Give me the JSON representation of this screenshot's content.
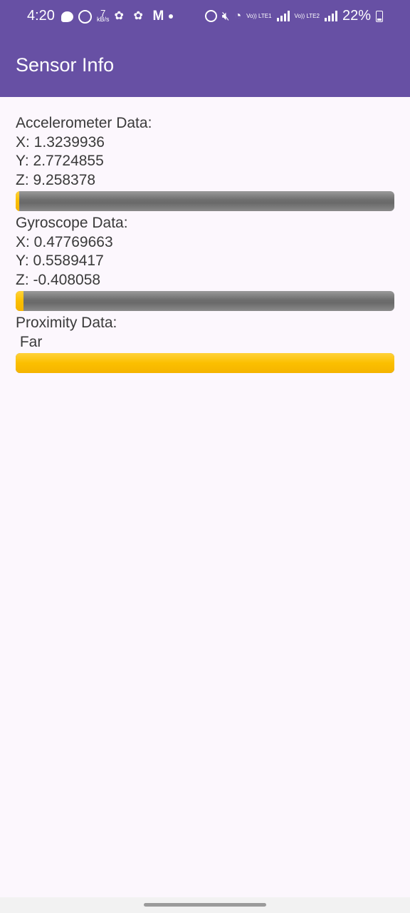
{
  "status_bar": {
    "time": "4:20",
    "data_rate_value": "7",
    "data_rate_unit": "kB/s",
    "sim1_label": "Vo)) LTE1",
    "sim2_label": "Vo)) LTE2",
    "battery": "22%"
  },
  "app_bar": {
    "title": "Sensor Info",
    "color": "#6750a4"
  },
  "accelerometer": {
    "heading": "Accelerometer Data:",
    "x": "X: 1.3239936",
    "y": "Y: 2.7724855",
    "z": "Z: 9.258378",
    "progress_percent": 1
  },
  "gyroscope": {
    "heading": "Gyroscope Data:",
    "x": "X: 0.47769663",
    "y": "Y: 0.5589417",
    "z": "Z: -0.408058",
    "progress_percent": 2
  },
  "proximity": {
    "heading": "Proximity Data:",
    "value": " Far",
    "progress_percent": 100
  },
  "colors": {
    "progress_fill": "#fbbf00",
    "progress_track": "#6d6d6d",
    "background": "#fcf7fd"
  }
}
